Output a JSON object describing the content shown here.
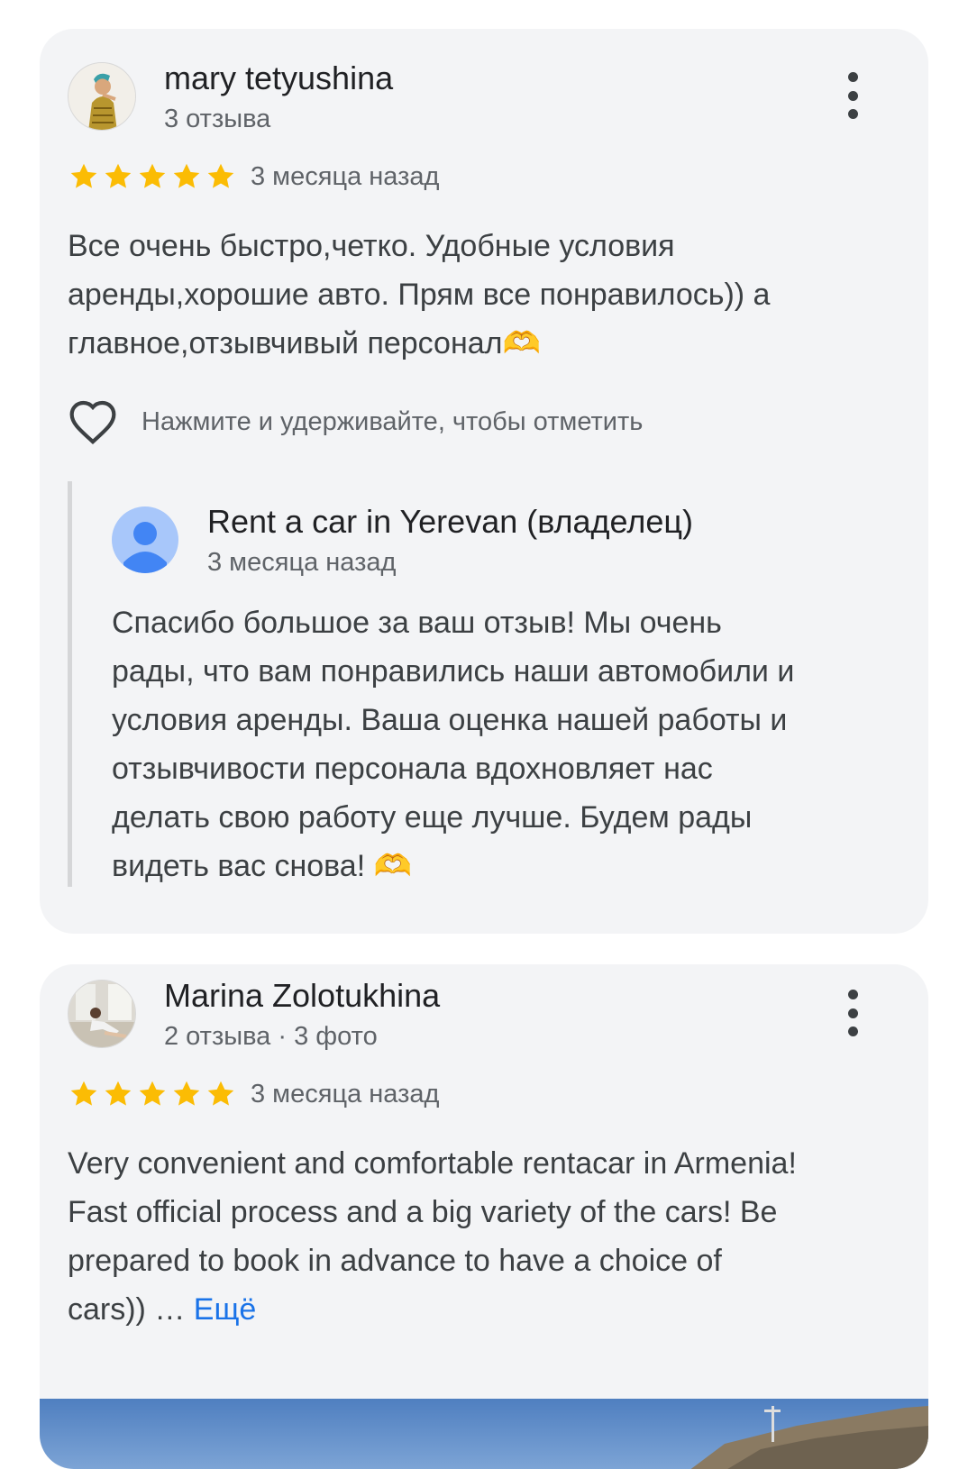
{
  "reviews": [
    {
      "author": "mary tetyushina",
      "author_meta": "3 отзыва",
      "rating": 5,
      "date": "3 месяца назад",
      "text_lines": [
        "Все очень быстро,четко. Удобные условия",
        "аренды,хорошие авто. Прям все понравилось)) а",
        "главное,отзывчивый персонал🫶"
      ],
      "like_hint": "Нажмите и удерживайте, чтобы отметить",
      "owner_reply": {
        "author": "Rent a car in Yerevan (владелец)",
        "date": "3 месяца назад",
        "text_lines": [
          "Спасибо большое за ваш отзыв! Мы очень",
          "рады, что вам понравились наши автомобили и",
          "условия аренды. Ваша оценка нашей работы и",
          "отзывчивости персонала вдохновляет нас",
          "делать свою работу еще лучше. Будем рады",
          "видеть вас снова! 🫶"
        ]
      }
    },
    {
      "author": "Marina Zolotukhina",
      "author_meta": "2 отзыва · 3 фото",
      "rating": 5,
      "date": "3 месяца назад",
      "text_lines": [
        "Very convenient and comfortable rentacar in Armenia!",
        "Fast official process and a big variety of the cars! Be",
        "prepared to book in advance to have a choice of",
        "cars)) … "
      ],
      "more_label": "Ещё"
    }
  ],
  "colors": {
    "card_bg": "#f3f4f6",
    "star": "#fbbc04",
    "link": "#1a73e8",
    "owner_avatar_bg": "#a8c7fa",
    "owner_avatar_fg": "#4285f4"
  },
  "icons": [
    "star-icon",
    "heart-outline-icon",
    "more-vert-icon",
    "person-icon"
  ]
}
